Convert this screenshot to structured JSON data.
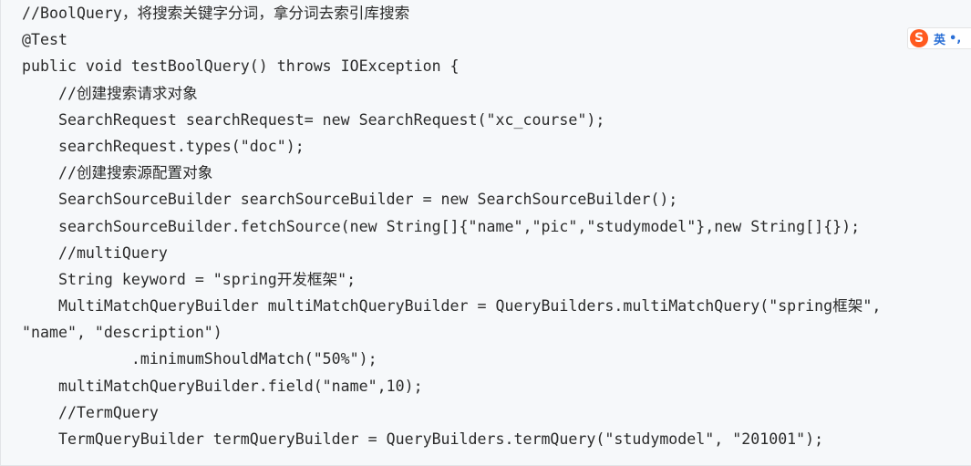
{
  "code": {
    "lines": [
      "//BoolQuery，将搜索关键字分词，拿分词去索引库搜索",
      "@Test",
      "public void testBoolQuery() throws IOException {",
      "    //创建搜索请求对象",
      "    SearchRequest searchRequest= new SearchRequest(\"xc_course\");",
      "    searchRequest.types(\"doc\");",
      "    //创建搜索源配置对象",
      "    SearchSourceBuilder searchSourceBuilder = new SearchSourceBuilder();",
      "    searchSourceBuilder.fetchSource(new String[]{\"name\",\"pic\",\"studymodel\"},new String[]{});",
      "    //multiQuery",
      "    String keyword = \"spring开发框架\";",
      "    MultiMatchQueryBuilder multiMatchQueryBuilder = QueryBuilders.multiMatchQuery(\"spring框架\",",
      "\"name\", \"description\")",
      "            .minimumShouldMatch(\"50%\");",
      "    multiMatchQueryBuilder.field(\"name\",10);",
      "    //TermQuery",
      "    TermQueryBuilder termQueryBuilder = QueryBuilders.termQuery(\"studymodel\", \"201001\");"
    ]
  },
  "ime": {
    "logo": "S",
    "language": "英",
    "punctuation": "•,",
    "icon": "sogou-ime-icon"
  },
  "colors": {
    "background": "#f6f8fa",
    "text": "#2b2b2b",
    "ime_logo": "#ff5a1f",
    "ime_text": "#2a6fd6"
  }
}
